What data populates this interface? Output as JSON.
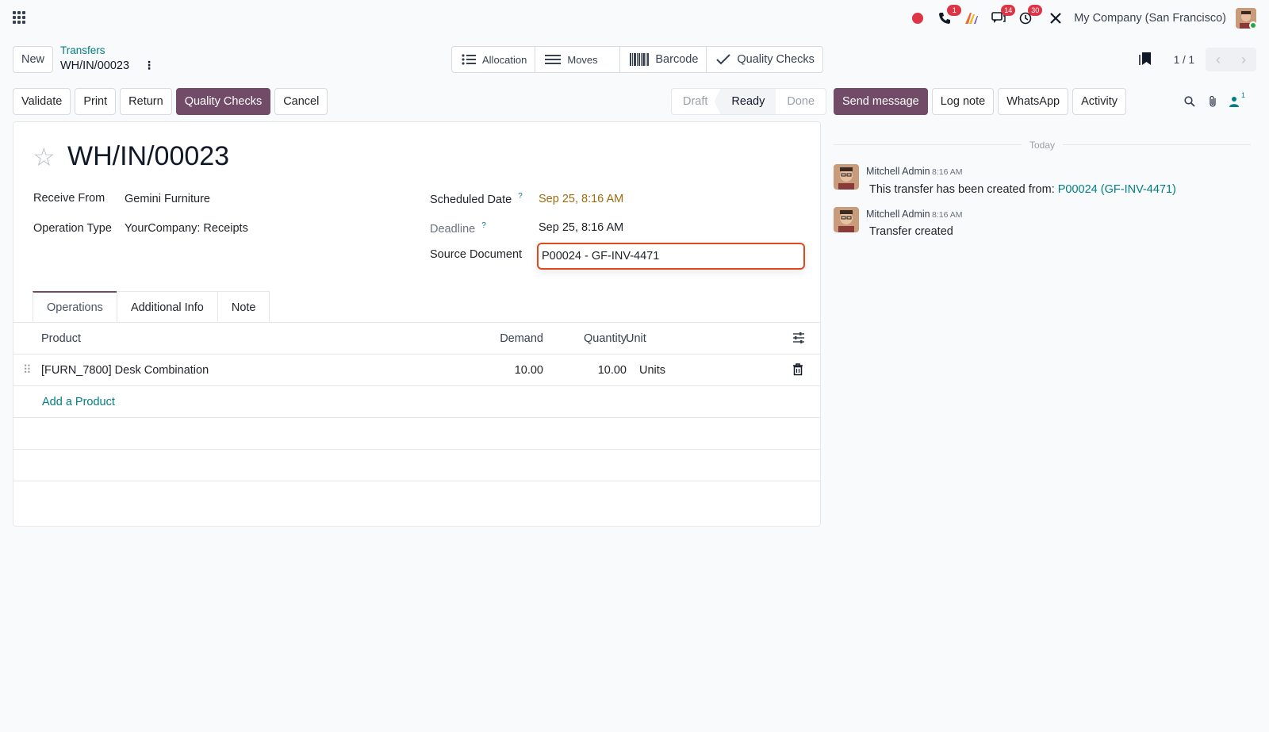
{
  "topbar": {
    "company": "My Company (San Francisco)",
    "badges": {
      "phone": "1",
      "messages": "14",
      "activities": "30"
    }
  },
  "control": {
    "new_label": "New",
    "breadcrumb_parent": "Transfers",
    "breadcrumb_current": "WH/IN/00023",
    "smart_buttons": [
      "Allocation",
      "Moves",
      "Barcode",
      "Quality Checks"
    ],
    "pager": "1 / 1"
  },
  "actions": {
    "validate": "Validate",
    "print": "Print",
    "return": "Return",
    "quality_checks": "Quality Checks",
    "cancel": "Cancel"
  },
  "status": {
    "steps": [
      "Draft",
      "Ready",
      "Done"
    ],
    "current": "Ready"
  },
  "form": {
    "title": "WH/IN/00023",
    "receive_from_label": "Receive From",
    "receive_from": "Gemini Furniture",
    "operation_type_label": "Operation Type",
    "operation_type": "YourCompany: Receipts",
    "scheduled_date_label": "Scheduled Date",
    "scheduled_date": "Sep 25, 8:16 AM",
    "deadline_label": "Deadline",
    "deadline": "Sep 25, 8:16 AM",
    "source_document_label": "Source Document",
    "source_document": "P00024 - GF-INV-4471",
    "help_mark": "?"
  },
  "tabs": [
    "Operations",
    "Additional Info",
    "Note"
  ],
  "operations": {
    "headers": {
      "product": "Product",
      "demand": "Demand",
      "quantity": "Quantity",
      "unit": "Unit"
    },
    "rows": [
      {
        "product": "[FURN_7800] Desk Combination",
        "demand": "10.00",
        "quantity": "10.00",
        "unit": "Units"
      }
    ],
    "add_label": "Add a Product"
  },
  "chatter": {
    "send_message": "Send message",
    "log_note": "Log note",
    "whatsapp": "WhatsApp",
    "activity": "Activity",
    "followers_count": "1",
    "separator": "Today",
    "messages": [
      {
        "author": "Mitchell Admin",
        "time": "8:16 AM",
        "text": "This transfer has been created from: ",
        "link": "P00024 (GF-INV-4471)"
      },
      {
        "author": "Mitchell Admin",
        "time": "8:16 AM",
        "text": "Transfer created"
      }
    ]
  },
  "colors": {
    "primary": "#714b67",
    "link": "#017e84",
    "warning_date": "#9c6b0d",
    "focus_border": "#e0491e",
    "badge": "#dc3545"
  }
}
